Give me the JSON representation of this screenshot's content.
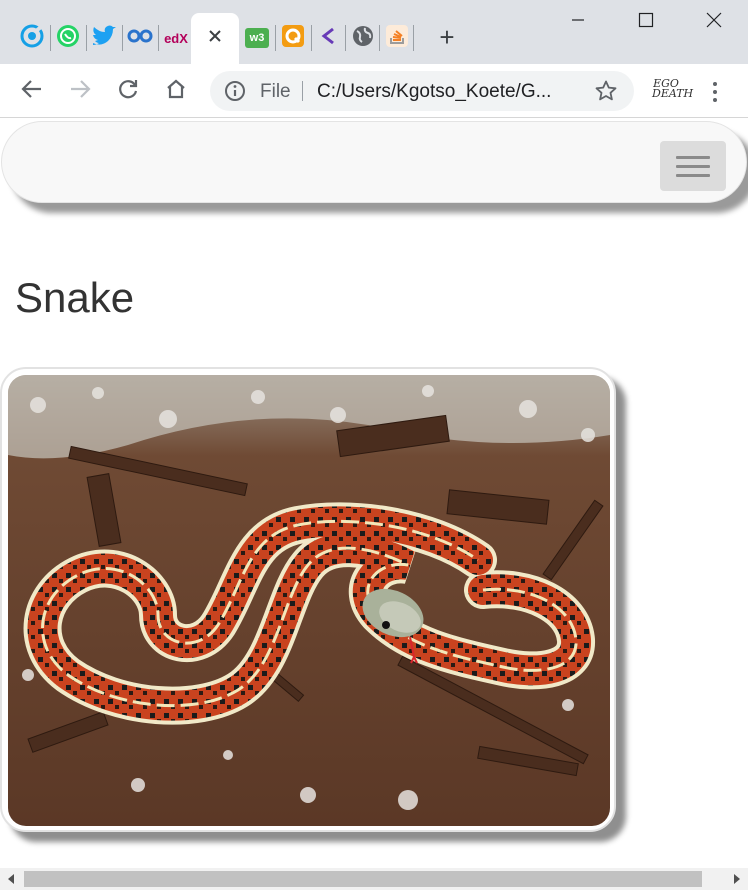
{
  "browser": {
    "tabs": [
      {
        "icon": "grammarly-icon",
        "color": "#15c39a"
      },
      {
        "icon": "whatsapp-icon",
        "color": "#25d366"
      },
      {
        "icon": "twitter-icon",
        "color": "#1da1f2"
      },
      {
        "icon": "coursera-icon",
        "color": "#2a73cc"
      },
      {
        "icon": "edx-icon",
        "color": "#02262b",
        "text": "edX"
      },
      {
        "icon": "close-icon",
        "active": true
      },
      {
        "icon": "w3schools-icon",
        "color": "#4caf50",
        "text": "w3"
      },
      {
        "icon": "quiz-icon",
        "color": "#f39c12"
      },
      {
        "icon": "code-icon",
        "color": "#673ab7"
      },
      {
        "icon": "globe-icon",
        "color": "#5f6368"
      },
      {
        "icon": "stackoverflow-icon",
        "color": "#f48024"
      }
    ],
    "new_tab_label": "+",
    "omnibox": {
      "scheme_label": "File",
      "url": "C:/Users/Kgotso_Koete/G..."
    },
    "extension_label": "EGO DEATH"
  },
  "page": {
    "title": "Snake",
    "image_subject": "garter snake on bark mulch"
  },
  "colors": {
    "tabstrip_bg": "#dee1e6",
    "navbar_bg": "#f8f8f8",
    "title_color": "#333333"
  }
}
